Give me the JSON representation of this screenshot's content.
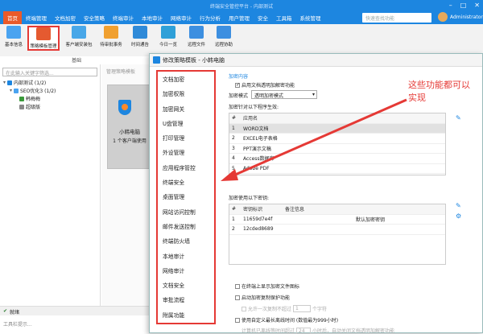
{
  "window": {
    "title": "终端安全管控平台 - 内部测试"
  },
  "menubar": {
    "tabs": [
      "首页",
      "终端管理",
      "文档加密",
      "安全策略",
      "终端审计",
      "本地审计",
      "网络审计",
      "行为分析",
      "用户管理",
      "安全",
      "工具箱",
      "系统管理"
    ],
    "active_tab": 0,
    "search_placeholder": "快速查找功能",
    "user": "Administrator"
  },
  "toolbar": {
    "items": [
      "基本信息",
      "策略模板管理",
      "客户端安装包",
      "待审批事务",
      "时间通告",
      "今日一览",
      "远程文件",
      "远程协助"
    ],
    "group_label": "基础"
  },
  "left": {
    "filter_placeholder": "在此输入关键字筛选...",
    "tree": {
      "root": "内部测试 (1/2)",
      "group": "SEO优化3 (1/2)",
      "user1": "韩梅梅",
      "user2": "超级版"
    }
  },
  "mid": {
    "header": "管理策略模板",
    "card_name": "小韩电脑",
    "card_count": "1 个客户端使用"
  },
  "statusbar": {
    "text": "就绪"
  },
  "bottom_note": "工具栏提示...",
  "dialog": {
    "title": "修改策略模板 - 小韩电脑",
    "modules": [
      "文档加密",
      "加密权限",
      "加密网关",
      "U盘管理",
      "打印管理",
      "外设管理",
      "应用程序管控",
      "终端安全",
      "桌面管理",
      "网站访问控制",
      "邮件发送控制",
      "终端防火墙",
      "本地审计",
      "网络审计",
      "文档安全",
      "审批流程",
      "附属功能"
    ],
    "section": "加密内容",
    "enable_label": "启用文档透明加解密功能",
    "mode_label": "加密模式",
    "mode_value": "透明加密模式",
    "programs_label": "加密针对以下程序生效:",
    "programs_header": [
      "#",
      "应用名"
    ],
    "programs": [
      {
        "n": "1",
        "name": "WORD文档"
      },
      {
        "n": "2",
        "name": "EXCEL电子表格"
      },
      {
        "n": "3",
        "name": "PPT演示文稿"
      },
      {
        "n": "4",
        "name": "Access数据库"
      },
      {
        "n": "5",
        "name": "Adobe PDF"
      }
    ],
    "keys_label": "加密使用以下密钥:",
    "keys_header": [
      "#",
      "密钥标识",
      "备注信息"
    ],
    "keys": [
      {
        "n": "1",
        "id": "11659d7e4f",
        "note": "",
        "extra": "默认加密密钥"
      },
      {
        "n": "2",
        "id": "12cded8689",
        "note": "",
        "extra": ""
      }
    ],
    "opt1": "在终端上显示加密文件图标",
    "opt2": "启动加密复制保护功能",
    "opt3": "允许一次复制不超过",
    "opt3_value": "1",
    "opt3_unit": "个字符",
    "opt4": "使用自定义最长离线时间 (数值最为999小时)",
    "opt5_prefix": "计算机已离线等时间超过",
    "opt5_value": "24",
    "opt5_suffix": "小时后，自动关闭文档透明加解密功能"
  },
  "annotation": {
    "line1": "这些功能都可以",
    "line2": "实现"
  },
  "colors": {
    "primary": "#1d86e0",
    "active_tab": "#ea5a2a",
    "highlight": "#e53935"
  }
}
